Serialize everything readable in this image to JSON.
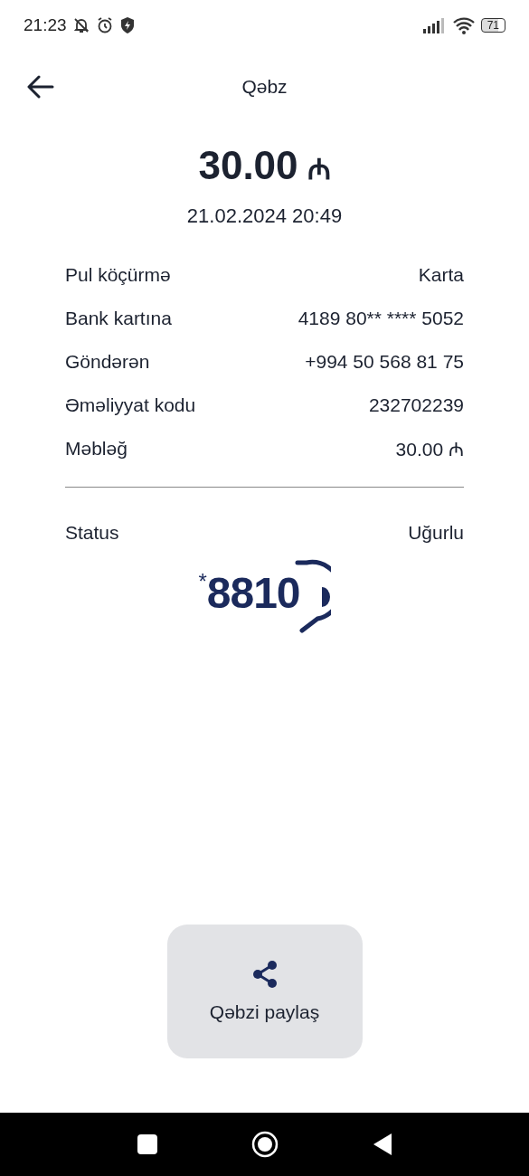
{
  "status_bar": {
    "time": "21:23",
    "battery": "71"
  },
  "header": {
    "title": "Qəbz"
  },
  "amount": {
    "value": "30.00",
    "currency": "₼"
  },
  "date": "21.02.2024 20:49",
  "details": [
    {
      "label": "Pul köçürmə",
      "value": "Karta"
    },
    {
      "label": "Bank kartına",
      "value": "4189 80** **** 5052"
    },
    {
      "label": "Göndərən",
      "value": "+994 50 568 81 75"
    },
    {
      "label": "Əməliyyat kodu",
      "value": "232702239"
    },
    {
      "label": "Məbləğ",
      "value": "30.00 ₼"
    }
  ],
  "status": {
    "label": "Status",
    "value": "Uğurlu"
  },
  "logo": {
    "mark": "*",
    "number": "8810"
  },
  "share_button": {
    "label": "Qəbzi paylaş"
  }
}
